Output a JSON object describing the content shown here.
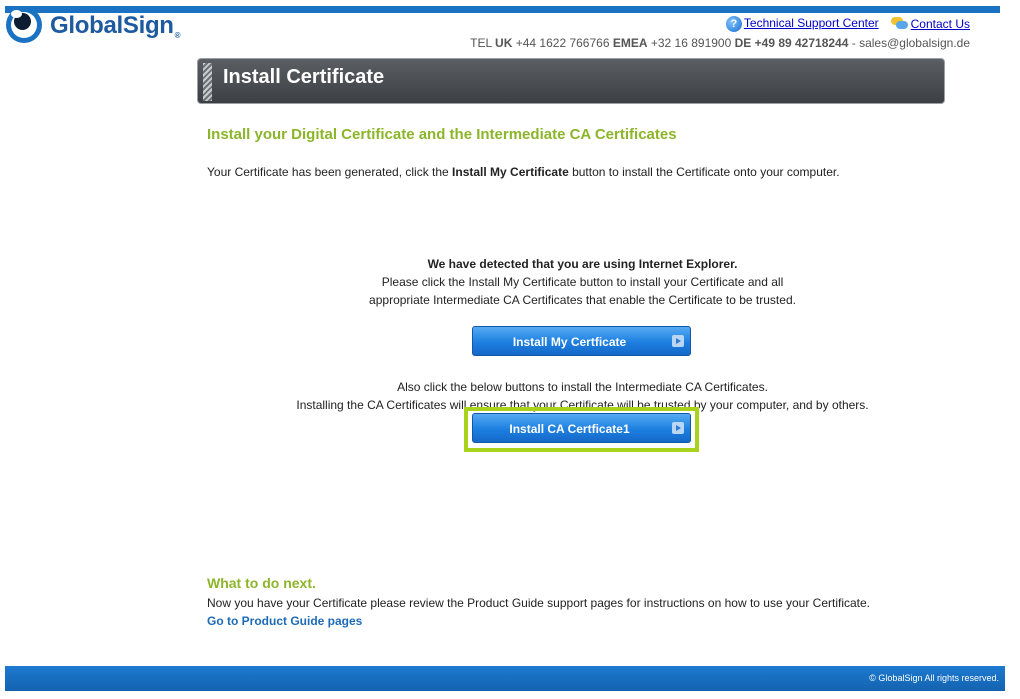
{
  "brand": {
    "name": "GlobalSign",
    "reg": "®"
  },
  "support": {
    "technical_label": "Technical Support Center",
    "contact_label": "Contact Us"
  },
  "contact": {
    "tel_prefix": "TEL",
    "uk_label": "UK",
    "uk_number": "+44 1622 766766",
    "emea_label": "EMEA",
    "emea_number": "+32 16 891900",
    "de_label": "DE",
    "de_number": "+49 89 42718244",
    "email_sep": " - ",
    "email": "sales@globalsign.de"
  },
  "header": {
    "title": "Install Certificate"
  },
  "main": {
    "section_title": "Install your Digital Certificate and the Intermediate CA Certificates",
    "intro_before": "Your Certificate has been generated, click the ",
    "intro_bold": "Install My Certificate",
    "intro_after": " button to install the Certificate onto your computer.",
    "ie_detected": "We have detected that you are using Internet Explorer.",
    "ie_line2": "Please click the Install My Certificate button to install your Certificate and all",
    "ie_line3": "appropriate Intermediate CA Certificates that enable the Certificate to be trusted.",
    "install_my_button": "Install My Certficate",
    "also_line1": "Also click the below buttons to install the Intermediate CA Certificates.",
    "also_line2": "Installing the CA Certificates will ensure that your Certificate will be trusted by your computer, and by others.",
    "install_ca_button": "Install CA Certficate1"
  },
  "next": {
    "title": "What to do next.",
    "text": "Now you have your Certificate please review the Product Guide support pages for instructions on how to use your Certificate.",
    "link": "Go to Product Guide pages"
  },
  "footer": {
    "copyright": "© GlobalSign All rights reserved."
  },
  "colors": {
    "brand_blue": "#1a73c2",
    "accent_green": "#8cb52a",
    "highlight_green": "#a8d21c"
  }
}
